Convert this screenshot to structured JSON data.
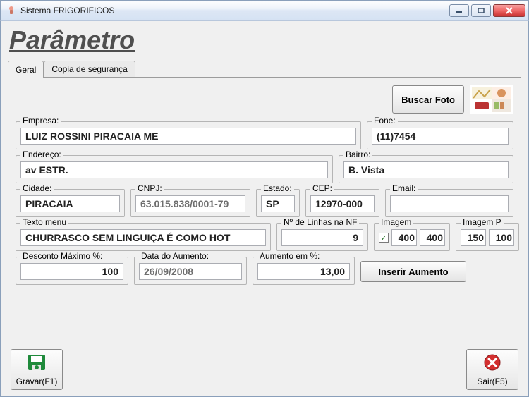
{
  "window": {
    "title": "Sistema FRIGORIFICOS"
  },
  "page_title": "Parâmetro",
  "tabs": {
    "geral": "Geral",
    "backup": "Copia de segurança"
  },
  "buttons": {
    "buscar_foto": "Buscar Foto",
    "inserir_aumento": "Inserir Aumento",
    "gravar": "Gravar(F1)",
    "sair": "Sair(F5)"
  },
  "labels": {
    "empresa": "Empresa:",
    "fone": "Fone:",
    "endereco": "Endereço:",
    "bairro": "Bairro:",
    "cidade": "Cidade:",
    "cnpj": "CNPJ:",
    "estado": "Estado:",
    "cep": "CEP:",
    "email": "Email:",
    "texto_menu": "Texto menu",
    "num_linhas_nf": "Nº de Linhas na NF",
    "imagem": "Imagem",
    "imagem_p": "Imagem P",
    "desconto_max": "Desconto Máximo %:",
    "data_aumento": "Data do Aumento:",
    "aumento_pct": "Aumento em %:"
  },
  "values": {
    "empresa": "LUIZ ROSSINI PIRACAIA ME",
    "fone": "(11)7454",
    "endereco": "av ESTR.",
    "bairro": "B. Vista",
    "cidade": "PIRACAIA",
    "cnpj": "63.015.838/0001-79",
    "estado": "SP",
    "cep": "12970-000",
    "email": "",
    "texto_menu": "CHURRASCO SEM LINGUIÇA É COMO HOT",
    "num_linhas_nf": "9",
    "imagem_checked": true,
    "imagem_w": "400",
    "imagem_h": "400",
    "imagem_p_w": "150",
    "imagem_p_h": "100",
    "desconto_max": "100",
    "data_aumento": "26/09/2008",
    "aumento_pct": "13,00"
  }
}
